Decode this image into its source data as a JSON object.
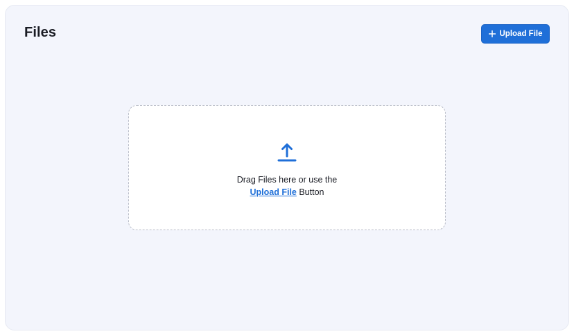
{
  "page": {
    "title": "Files"
  },
  "toolbar": {
    "upload_label": "Upload File"
  },
  "dropzone": {
    "line1": "Drag Files here or use the",
    "link_label": "Upload File",
    "line2_suffix": " Button"
  },
  "icons": {
    "upload_button_icon": "plus-icon",
    "dropzone_icon": "upload-arrow-icon"
  },
  "colors": {
    "accent": "#1f6fd8",
    "panel_background": "#f3f5fc",
    "dropzone_border": "#b8bcc8"
  }
}
